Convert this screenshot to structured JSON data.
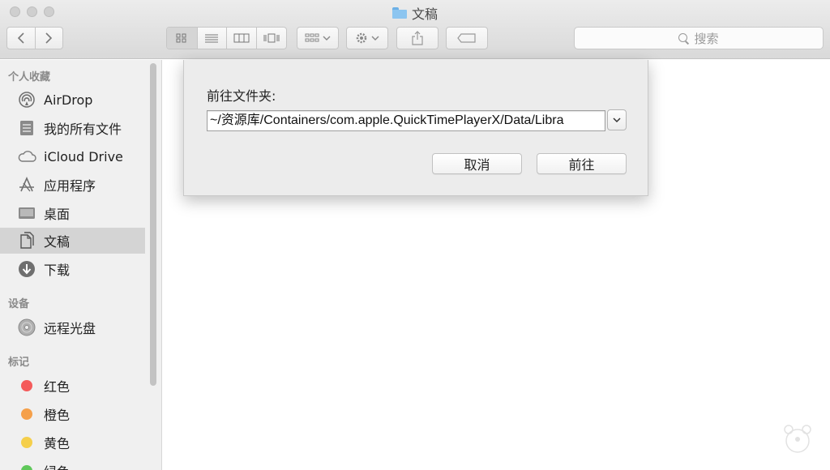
{
  "window": {
    "title": "文稿"
  },
  "toolbar": {
    "back_icon": "chevron-left",
    "forward_icon": "chevron-right",
    "search_placeholder": "搜索"
  },
  "sidebar": {
    "favorites_header": "个人收藏",
    "favorites": [
      {
        "label": "AirDrop",
        "icon": "airdrop-icon"
      },
      {
        "label": "我的所有文件",
        "icon": "all-files-icon"
      },
      {
        "label": "iCloud Drive",
        "icon": "cloud-icon"
      },
      {
        "label": "应用程序",
        "icon": "applications-icon"
      },
      {
        "label": "桌面",
        "icon": "desktop-icon"
      },
      {
        "label": "文稿",
        "icon": "documents-icon",
        "selected": true
      },
      {
        "label": "下载",
        "icon": "download-icon"
      }
    ],
    "devices_header": "设备",
    "devices": [
      {
        "label": "远程光盘",
        "icon": "disc-icon"
      }
    ],
    "tags_header": "标记",
    "tags": [
      {
        "label": "红色",
        "color": "#f45b5b"
      },
      {
        "label": "橙色",
        "color": "#f5a04a"
      },
      {
        "label": "黄色",
        "color": "#f5cf4b"
      },
      {
        "label": "绿色",
        "color": "#5fc85a"
      }
    ]
  },
  "dialog": {
    "title": "前往文件夹:",
    "path_value": "~/资源库/Containers/com.apple.QuickTimePlayerX/Data/Libra",
    "cancel_label": "取消",
    "go_label": "前往"
  }
}
